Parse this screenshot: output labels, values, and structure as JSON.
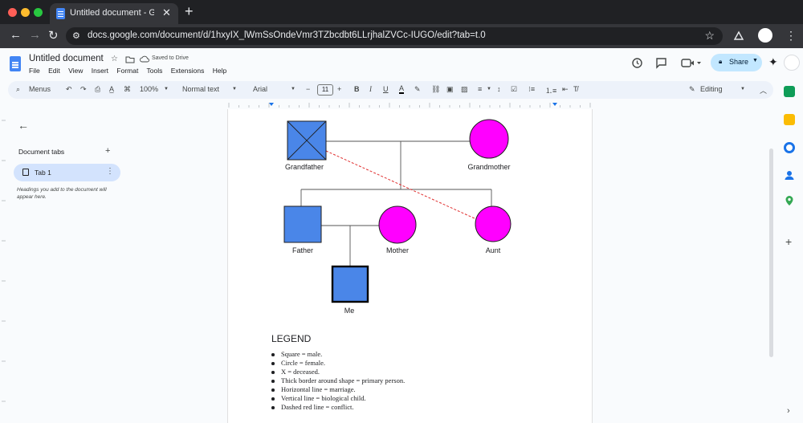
{
  "browser": {
    "tab_title": "Untitled document - Google Docs",
    "tab_close": "✕",
    "new_tab": "+",
    "url": "docs.google.com/document/d/1hxyIX_lWmSsOndeVmr3TZbcdbt6LLrjhalZVCc-IUGO/edit?tab=t.0",
    "back": "←",
    "forward": "→",
    "reload": "↻",
    "tune_icon": "⚙",
    "star": "☆",
    "colors": {
      "close": "#ff5f57",
      "minimize": "#febc2e",
      "maximize": "#28c840"
    }
  },
  "docs": {
    "title": "Untitled document",
    "saved": "Saved to Drive",
    "menus": [
      "File",
      "Edit",
      "View",
      "Insert",
      "Format",
      "Tools",
      "Extensions",
      "Help"
    ],
    "share": "Share",
    "toolbar": {
      "menus": "Menus",
      "zoom": "100%",
      "style": "Normal text",
      "font": "Arial",
      "font_size": "11",
      "mode": "Editing"
    }
  },
  "sidebar": {
    "heading": "Document tabs",
    "add": "+",
    "tabs": [
      {
        "label": "Tab 1"
      }
    ],
    "hint": "Headings you add to the document will appear here."
  },
  "diagram": {
    "nodes": [
      {
        "id": "grandfather",
        "label": "Grandfather",
        "shape": "square",
        "deceased": true
      },
      {
        "id": "grandmother",
        "label": "Grandmother",
        "shape": "circle"
      },
      {
        "id": "father",
        "label": "Father",
        "shape": "square"
      },
      {
        "id": "mother",
        "label": "Mother",
        "shape": "circle"
      },
      {
        "id": "aunt",
        "label": "Aunt",
        "shape": "circle"
      },
      {
        "id": "me",
        "label": "Me",
        "shape": "square",
        "primary": true
      }
    ],
    "colors": {
      "male": "#4a86e8",
      "female": "#ff00ff",
      "conflict": "#e03030"
    }
  },
  "legend": {
    "title": "LEGEND",
    "items": [
      "Square = male.",
      "Circle = female.",
      "X = deceased.",
      "Thick border around shape = primary person.",
      "Horizontal line = marriage.",
      "Vertical line = biological child.",
      "Dashed red line = conflict."
    ]
  }
}
